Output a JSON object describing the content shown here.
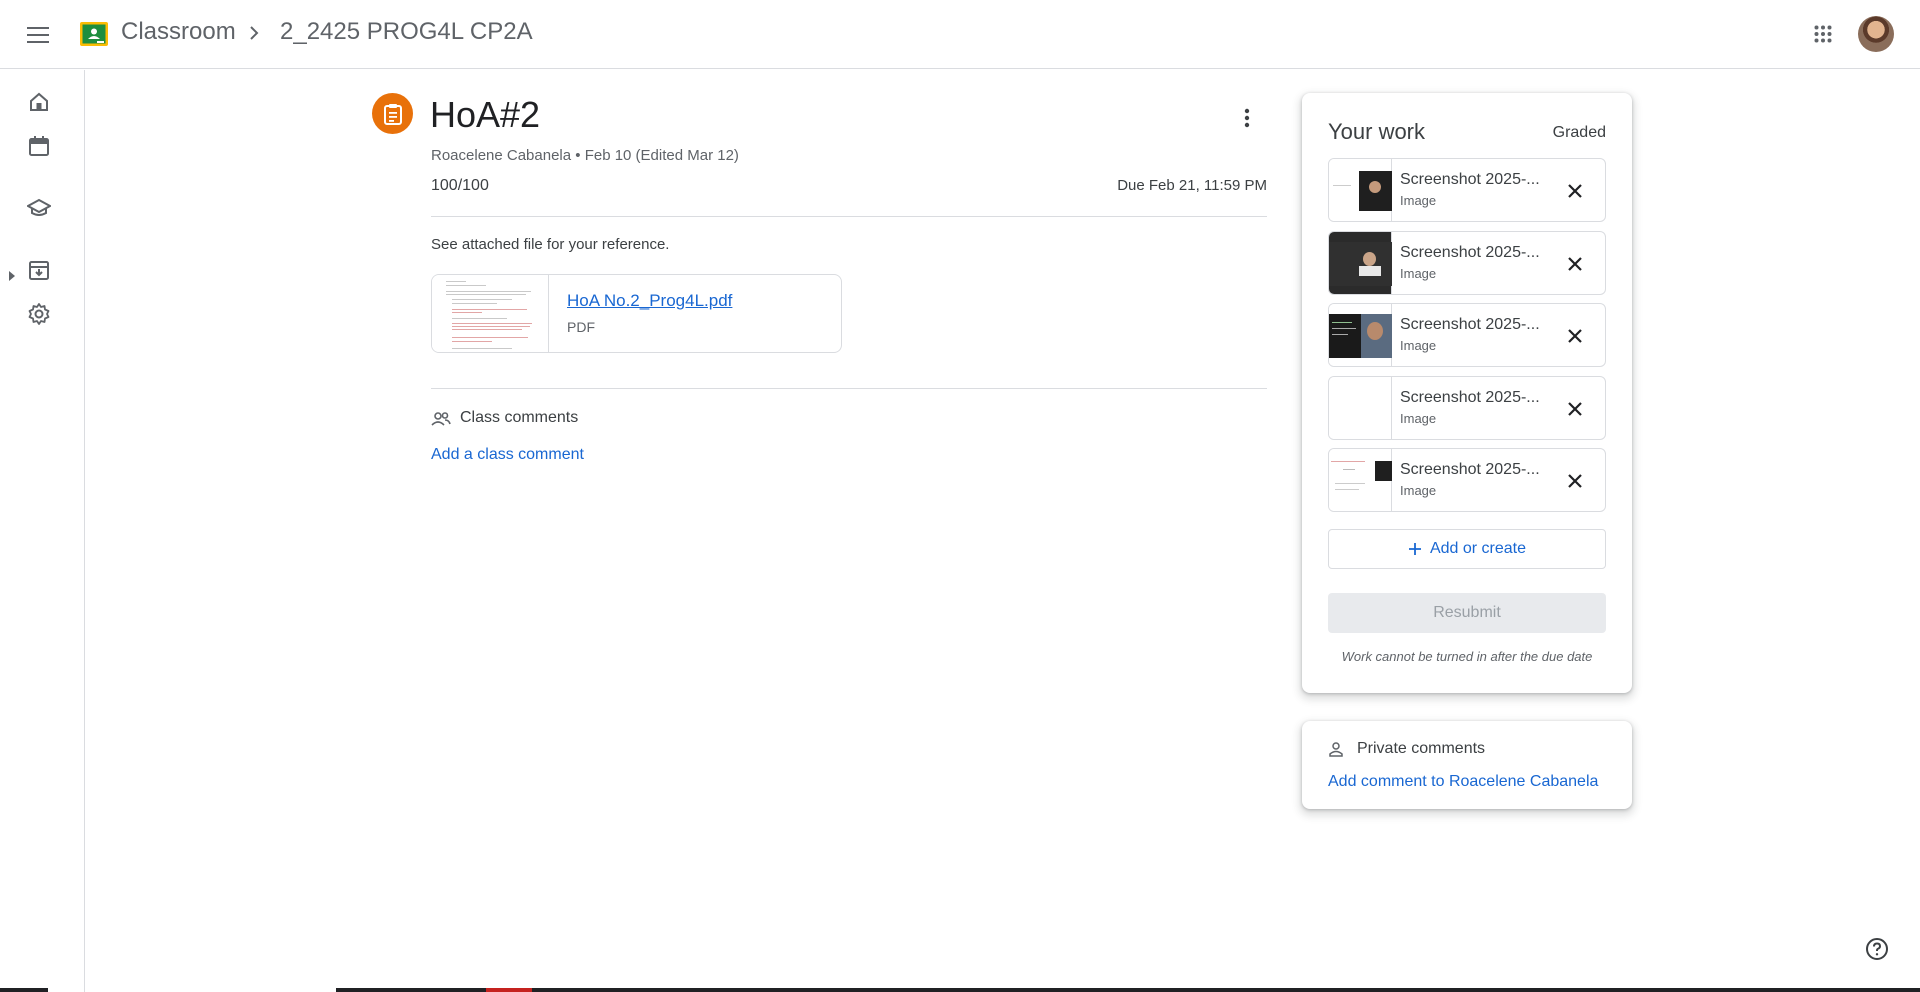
{
  "header": {
    "app_title": "Classroom",
    "class_name": "2_2425 PROG4L CP2A"
  },
  "rail": {
    "items": [
      {
        "name": "Home",
        "icon": "home-icon"
      },
      {
        "name": "Calendar",
        "icon": "calendar-icon"
      },
      {
        "name": "Enrolled",
        "icon": "school-icon"
      },
      {
        "name": "Archived classes",
        "icon": "archive-icon"
      },
      {
        "name": "Settings",
        "icon": "gear-icon"
      }
    ]
  },
  "assignment": {
    "title": "HoA#2",
    "meta": "Roacelene Cabanela • Feb 10 (Edited Mar 12)",
    "points": "100/100",
    "due": "Due Feb 21, 11:59 PM",
    "description": "See attached file for your reference.",
    "attachment": {
      "name": "HoA No.2_Prog4L.pdf",
      "type": "PDF"
    }
  },
  "class_comments": {
    "label": "Class comments",
    "add_label": "Add a class comment"
  },
  "your_work": {
    "title": "Your work",
    "status": "Graded",
    "files": [
      {
        "name": "Screenshot 2025-...",
        "type": "Image"
      },
      {
        "name": "Screenshot 2025-...",
        "type": "Image"
      },
      {
        "name": "Screenshot 2025-...",
        "type": "Image"
      },
      {
        "name": "Screenshot 2025-...",
        "type": "Image"
      },
      {
        "name": "Screenshot 2025-...",
        "type": "Image"
      }
    ],
    "add_label": "Add or create",
    "resubmit_label": "Resubmit",
    "note": "Work cannot be turned in after the due date"
  },
  "private_comments": {
    "label": "Private comments",
    "add_label": "Add comment to Roacelene Cabanela"
  },
  "colors": {
    "accent": "#1967d2",
    "assignment_icon": "#e8710a",
    "logo_green": "#1e8e3e",
    "logo_yellow": "#fbbc04"
  }
}
